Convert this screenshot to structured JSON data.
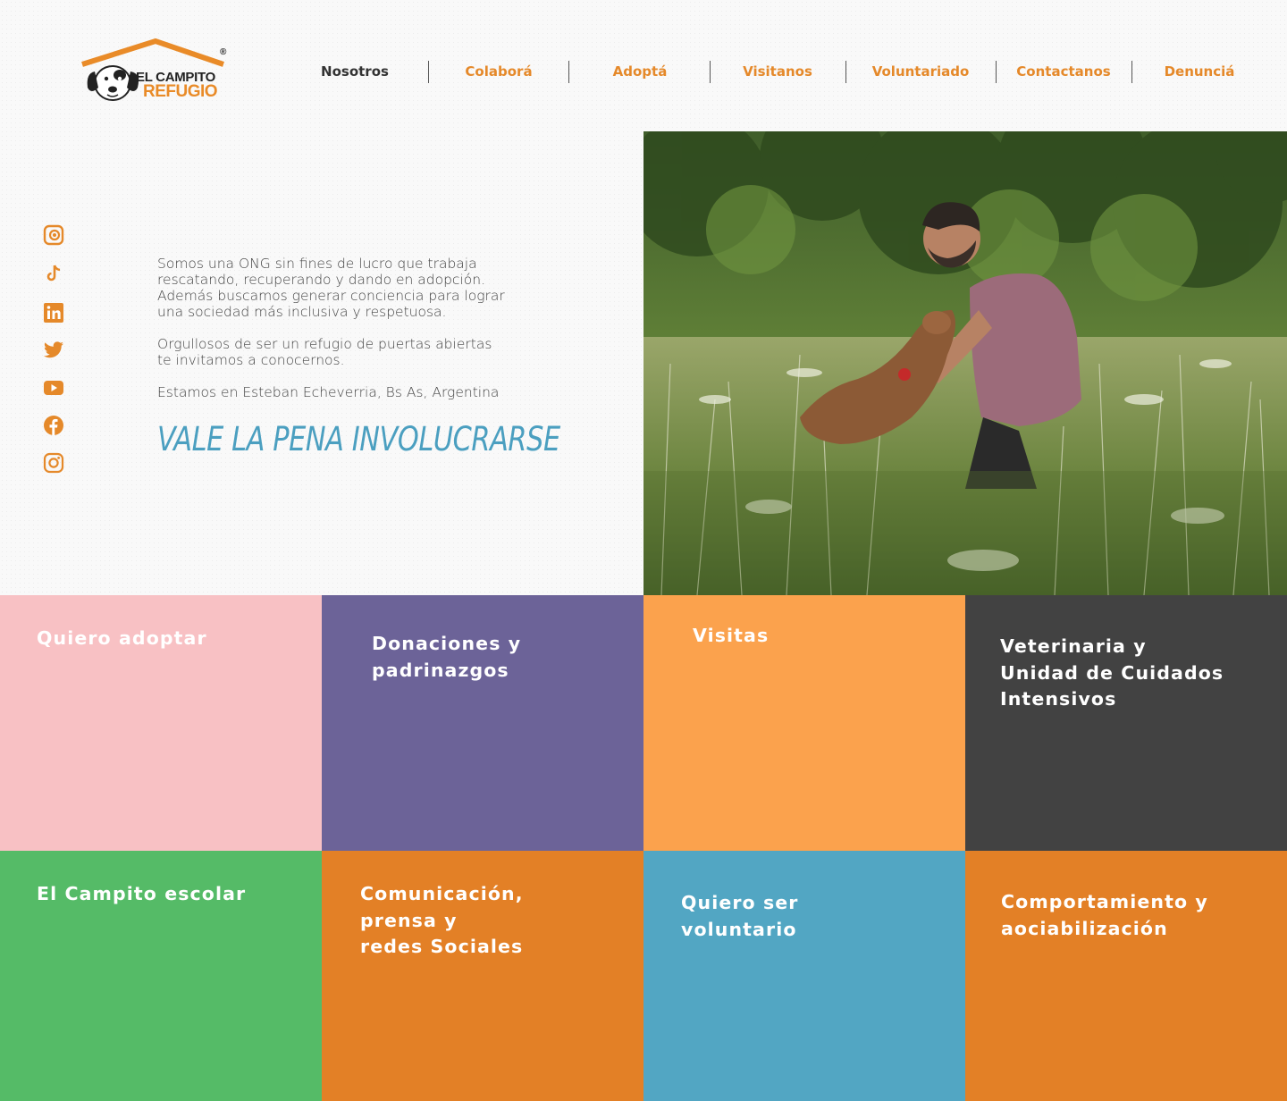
{
  "brand": {
    "line1": "EL CAMPITO",
    "line2": "REFUGIO",
    "registered": "®",
    "accent_color": "#e98b28"
  },
  "nav": {
    "items": [
      {
        "label": "Nosotros",
        "active": true
      },
      {
        "label": "Colaborá",
        "active": false
      },
      {
        "label": "Adoptá",
        "active": false
      },
      {
        "label": "Visitanos",
        "active": false
      },
      {
        "label": "Voluntariado",
        "active": false
      },
      {
        "label": "Contactanos",
        "active": false
      },
      {
        "label": "Denunciá",
        "active": false
      }
    ]
  },
  "socials": [
    {
      "name": "foursquare-icon"
    },
    {
      "name": "tiktok-icon"
    },
    {
      "name": "linkedin-icon"
    },
    {
      "name": "twitter-icon"
    },
    {
      "name": "youtube-icon"
    },
    {
      "name": "facebook-icon"
    },
    {
      "name": "instagram-icon"
    }
  ],
  "intro": {
    "p1_lines": [
      "Somos una ONG sin fines de lucro que trabaja",
      "rescatando, recuperando y dando en adopción.",
      "Además buscamos generar conciencia para lograr",
      "una sociedad más inclusiva y respetuosa."
    ],
    "p2_lines": [
      "Orgullosos de ser un refugio de puertas abiertas",
      "te invitamos a conocernos."
    ],
    "p3": "Estamos en Esteban Echeverria, Bs As, Argentina",
    "tagline": "VALE LA PENA INVOLUCRARSE"
  },
  "tiles": [
    {
      "label": "Quiero adoptar",
      "color": "#f8c1c4"
    },
    {
      "label": "Donaciones y\npadrinazgos",
      "color": "#6c6398"
    },
    {
      "label": "Visitas",
      "color": "#fba24d"
    },
    {
      "label": "Veterinaria y\nUnidad de Cuidados\nIntensivos",
      "color": "#424242"
    },
    {
      "label": "El Campito escolar",
      "color": "#55bb67"
    },
    {
      "label": "Comunicación,\nprensa y\nredes Sociales",
      "color": "#e38026"
    },
    {
      "label": "Quiero ser\nvoluntario",
      "color": "#52a6c3"
    },
    {
      "label": "Comportamiento y\naociabilización",
      "color": "#e38026"
    }
  ]
}
